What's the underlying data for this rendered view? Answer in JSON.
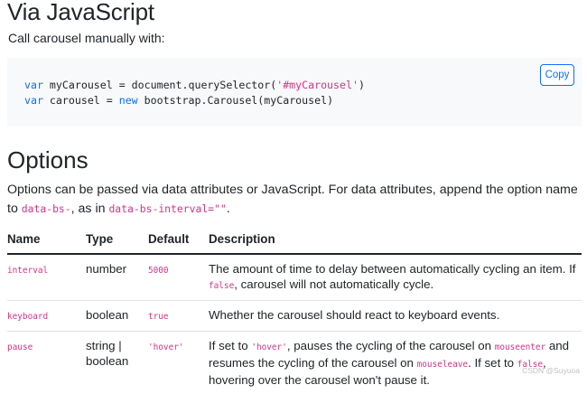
{
  "section1": {
    "title": "Via JavaScript",
    "lead": "Call carousel manually with:",
    "code": {
      "line1": {
        "kw": "var",
        "pre": " myCarousel = document.querySelector(",
        "str": "'#myCarousel'",
        "post": ")"
      },
      "line2": {
        "kw": "var",
        "pre": " carousel = ",
        "kw2": "new",
        "post": " bootstrap.Carousel(myCarousel)"
      },
      "copy_label": "Copy"
    }
  },
  "section2": {
    "title": "Options",
    "lead_a": "Options can be passed via data attributes or JavaScript. For data attributes, append the option name to ",
    "lead_code1": "data-bs-",
    "lead_b": ", as in ",
    "lead_code2": "data-bs-interval=\"\"",
    "lead_c": "."
  },
  "table": {
    "headers": [
      "Name",
      "Type",
      "Default",
      "Description"
    ],
    "rows": [
      {
        "name": "interval",
        "type": "number",
        "default": "5000",
        "desc_a": "The amount of time to delay between automatically cycling an item. If ",
        "desc_code1": "false",
        "desc_b": ", carousel will not automatically cycle."
      },
      {
        "name": "keyboard",
        "type": "boolean",
        "default": "true",
        "desc_a": "Whether the carousel should react to keyboard events."
      },
      {
        "name": "pause",
        "type_a": "string |",
        "type_b": "boolean",
        "default": "'hover'",
        "desc_a": "If set to ",
        "desc_code1": "'hover'",
        "desc_b": ", pauses the cycling of the carousel on ",
        "desc_code2": "mouseenter",
        "desc_c": " and resumes the cycling of the carousel on ",
        "desc_code3": "mouseleave",
        "desc_d": ". If set to ",
        "desc_code4": "false",
        "desc_e": ", hovering over the carousel won't pause it."
      }
    ]
  },
  "watermark": "CSDN @Suyuoa"
}
